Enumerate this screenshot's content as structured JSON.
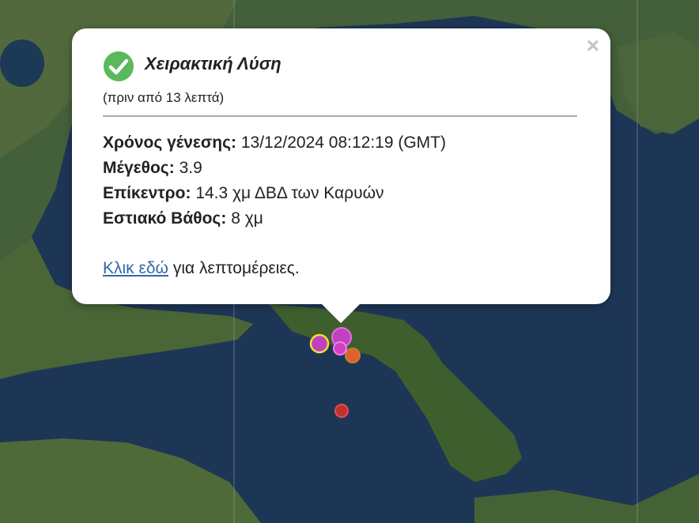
{
  "popup": {
    "title": "Χειρακτική Λύση",
    "time_ago": "(πριν από 13 λεπτά)",
    "origin_time_label": "Χρόνος γένεσης:",
    "origin_time_value": "13/12/2024 08:12:19 (GMT)",
    "magnitude_label": "Μέγεθος:",
    "magnitude_value": "3.9",
    "epicenter_label": "Επίκεντρο:",
    "epicenter_value": "14.3 χμ ΔΒΔ των Καρυών",
    "depth_label": "Εστιακό Βάθος:",
    "depth_value": "8 χμ",
    "link_text": "Κλικ εδώ",
    "link_suffix": "για λεπτομέρειες.",
    "close_symbol": "×",
    "status_icon": "check-circle-icon",
    "status_color": "#5cb85c"
  },
  "map": {
    "sea_color": "#1d3555",
    "land_color": "#3c5a2c",
    "event_markers": [
      {
        "color": "#c040c0",
        "type": "recent"
      },
      {
        "color": "#c040c0",
        "type": "recent"
      },
      {
        "color": "#d04080",
        "type": "recent"
      },
      {
        "color": "#e06030",
        "type": "older"
      },
      {
        "color": "#c03030",
        "type": "older"
      }
    ]
  }
}
